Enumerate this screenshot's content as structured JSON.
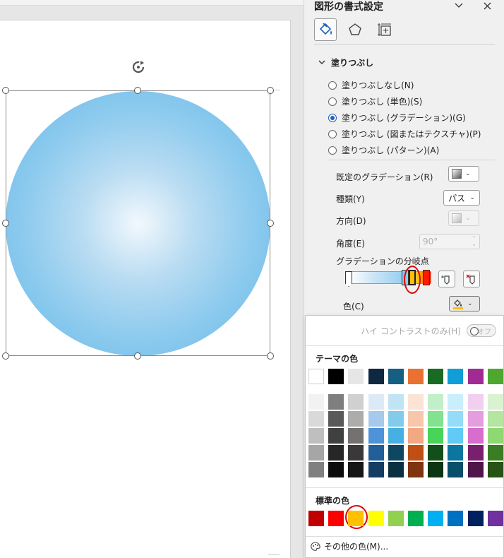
{
  "pane": {
    "title": "図形の書式設定",
    "tabs": [
      "fill-line-tab",
      "effects-tab",
      "size-properties-tab"
    ],
    "section_title": "塗りつぶし",
    "fill_options": [
      "塗りつぶしなし(N)",
      "塗りつぶし (単色)(S)",
      "塗りつぶし (グラデーション)(G)",
      "塗りつぶし (図またはテクスチャ)(P)",
      "塗りつぶし (パターン)(A)"
    ],
    "selected_fill_index": 2,
    "preset_label": "既定のグラデーション(R)",
    "type_label": "種類(Y)",
    "type_value": "パス",
    "direction_label": "方向(D)",
    "angle_label": "角度(E)",
    "angle_value": "90°",
    "stops_label": "グラデーションの分岐点",
    "color_label": "色(C)"
  },
  "popup": {
    "high_contrast_label": "ハイ コントラストのみ(H)",
    "toggle_state": "オフ",
    "theme_heading": "テーマの色",
    "standard_heading": "標準の色",
    "more_colors_label": "その他の色(M)...",
    "theme_top": [
      "#ffffff",
      "#000000",
      "#e7e6e6",
      "#0e2841",
      "#156082",
      "#e97132",
      "#196b24",
      "#0f9ed5",
      "#a02b93",
      "#4ea72e"
    ],
    "theme_tints": [
      [
        "#f2f2f2",
        "#7f7f7f",
        "#d0d0d0",
        "#dceaf7",
        "#c1e4f5",
        "#fbe3d6",
        "#c1f0c8",
        "#caeefb",
        "#f2cfee",
        "#d9f2d0"
      ],
      [
        "#d9d9d9",
        "#595959",
        "#aeabab",
        "#a6c9ec",
        "#83cbeb",
        "#f7c7ac",
        "#83e28e",
        "#94dcf8",
        "#e59edd",
        "#b4e5a2"
      ],
      [
        "#bfbfbf",
        "#404040",
        "#757171",
        "#4d93d9",
        "#45b0e1",
        "#f1a983",
        "#47d459",
        "#61cbf4",
        "#d86dcd",
        "#8ed973"
      ],
      [
        "#a6a6a6",
        "#262626",
        "#3a3838",
        "#215f9a",
        "#0f4761",
        "#c04f15",
        "#124f1a",
        "#0b76a0",
        "#78206e",
        "#3b7d23"
      ],
      [
        "#808080",
        "#0d0d0d",
        "#171616",
        "#153d64",
        "#0a2f41",
        "#7f350e",
        "#0c3511",
        "#074f6a",
        "#501549",
        "#275317"
      ]
    ],
    "standard": [
      "#c00000",
      "#ff0000",
      "#ffc000",
      "#ffff00",
      "#92d050",
      "#00b050",
      "#00b0f0",
      "#0070c0",
      "#002060",
      "#7030a0"
    ]
  },
  "colors": {
    "selected_color": "#ffc000",
    "accent": "#1f5fbf",
    "annotation": "#e00000"
  }
}
